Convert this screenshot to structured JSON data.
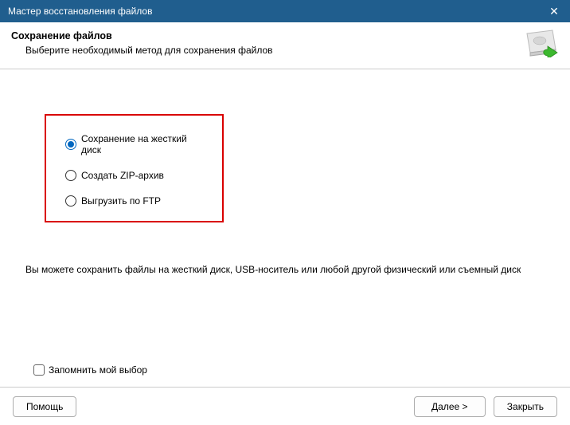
{
  "titlebar": {
    "text": "Мастер восстановления файлов"
  },
  "header": {
    "title": "Сохранение файлов",
    "subtitle": "Выберите необходимый метод для сохранения файлов"
  },
  "options": [
    {
      "label": "Сохранение на жесткий диск",
      "selected": true
    },
    {
      "label": "Создать ZIP-архив",
      "selected": false
    },
    {
      "label": "Выгрузить по FTP",
      "selected": false
    }
  ],
  "description": "Вы можете сохранить файлы на жесткий диск, USB-носитель или любой другой физический или съемный диск",
  "remember": {
    "label": "Запомнить мой выбор",
    "checked": false
  },
  "buttons": {
    "help": "Помощь",
    "next": "Далее >",
    "close": "Закрыть"
  }
}
